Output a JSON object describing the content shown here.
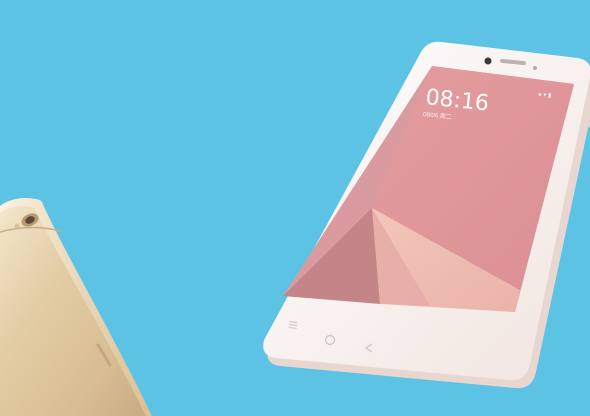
{
  "scene": {
    "background_color": "#5cc3e4",
    "subject": "two smartphones floating on a sky-blue background",
    "phones": [
      {
        "id": "front",
        "view": "front, screen on",
        "body_color": "#f4e7e1",
        "bezel_color": "#fbf5f2",
        "wallpaper_colors": [
          "#e7a7a6",
          "#f0c1b8",
          "#c98a8d",
          "#d8a0a2"
        ],
        "screen": {
          "time": "08:16",
          "date": "08/06 周二",
          "status": "● ▾ ▮"
        },
        "nav_keys": [
          "menu-key",
          "home-key",
          "back-key"
        ]
      },
      {
        "id": "back",
        "view": "rear, angled and cropped at left edge",
        "body_color": "#e0c9a2",
        "highlight_color": "#f1e2c7",
        "shadow_color": "#bfa67c",
        "details": [
          "camera",
          "antenna-line"
        ]
      }
    ]
  }
}
